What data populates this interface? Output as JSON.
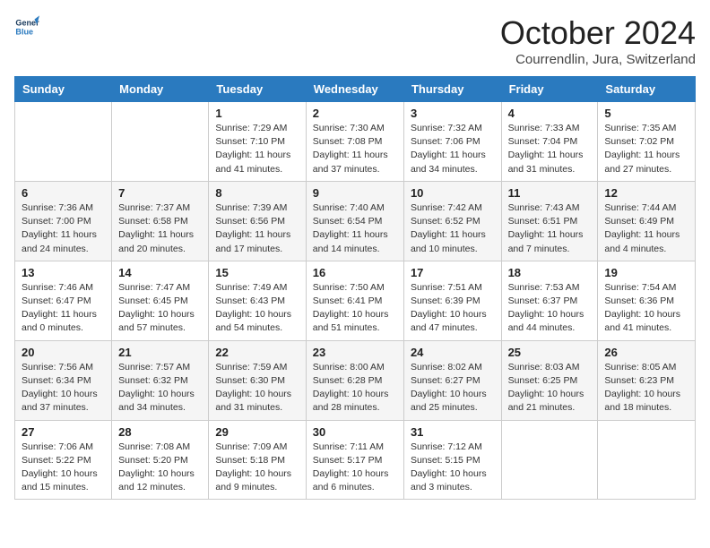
{
  "header": {
    "logo_line1": "General",
    "logo_line2": "Blue",
    "month": "October 2024",
    "location": "Courrendlin, Jura, Switzerland"
  },
  "days_of_week": [
    "Sunday",
    "Monday",
    "Tuesday",
    "Wednesday",
    "Thursday",
    "Friday",
    "Saturday"
  ],
  "weeks": [
    [
      {
        "day": "",
        "info": ""
      },
      {
        "day": "",
        "info": ""
      },
      {
        "day": "1",
        "info": "Sunrise: 7:29 AM\nSunset: 7:10 PM\nDaylight: 11 hours and 41 minutes."
      },
      {
        "day": "2",
        "info": "Sunrise: 7:30 AM\nSunset: 7:08 PM\nDaylight: 11 hours and 37 minutes."
      },
      {
        "day": "3",
        "info": "Sunrise: 7:32 AM\nSunset: 7:06 PM\nDaylight: 11 hours and 34 minutes."
      },
      {
        "day": "4",
        "info": "Sunrise: 7:33 AM\nSunset: 7:04 PM\nDaylight: 11 hours and 31 minutes."
      },
      {
        "day": "5",
        "info": "Sunrise: 7:35 AM\nSunset: 7:02 PM\nDaylight: 11 hours and 27 minutes."
      }
    ],
    [
      {
        "day": "6",
        "info": "Sunrise: 7:36 AM\nSunset: 7:00 PM\nDaylight: 11 hours and 24 minutes."
      },
      {
        "day": "7",
        "info": "Sunrise: 7:37 AM\nSunset: 6:58 PM\nDaylight: 11 hours and 20 minutes."
      },
      {
        "day": "8",
        "info": "Sunrise: 7:39 AM\nSunset: 6:56 PM\nDaylight: 11 hours and 17 minutes."
      },
      {
        "day": "9",
        "info": "Sunrise: 7:40 AM\nSunset: 6:54 PM\nDaylight: 11 hours and 14 minutes."
      },
      {
        "day": "10",
        "info": "Sunrise: 7:42 AM\nSunset: 6:52 PM\nDaylight: 11 hours and 10 minutes."
      },
      {
        "day": "11",
        "info": "Sunrise: 7:43 AM\nSunset: 6:51 PM\nDaylight: 11 hours and 7 minutes."
      },
      {
        "day": "12",
        "info": "Sunrise: 7:44 AM\nSunset: 6:49 PM\nDaylight: 11 hours and 4 minutes."
      }
    ],
    [
      {
        "day": "13",
        "info": "Sunrise: 7:46 AM\nSunset: 6:47 PM\nDaylight: 11 hours and 0 minutes."
      },
      {
        "day": "14",
        "info": "Sunrise: 7:47 AM\nSunset: 6:45 PM\nDaylight: 10 hours and 57 minutes."
      },
      {
        "day": "15",
        "info": "Sunrise: 7:49 AM\nSunset: 6:43 PM\nDaylight: 10 hours and 54 minutes."
      },
      {
        "day": "16",
        "info": "Sunrise: 7:50 AM\nSunset: 6:41 PM\nDaylight: 10 hours and 51 minutes."
      },
      {
        "day": "17",
        "info": "Sunrise: 7:51 AM\nSunset: 6:39 PM\nDaylight: 10 hours and 47 minutes."
      },
      {
        "day": "18",
        "info": "Sunrise: 7:53 AM\nSunset: 6:37 PM\nDaylight: 10 hours and 44 minutes."
      },
      {
        "day": "19",
        "info": "Sunrise: 7:54 AM\nSunset: 6:36 PM\nDaylight: 10 hours and 41 minutes."
      }
    ],
    [
      {
        "day": "20",
        "info": "Sunrise: 7:56 AM\nSunset: 6:34 PM\nDaylight: 10 hours and 37 minutes."
      },
      {
        "day": "21",
        "info": "Sunrise: 7:57 AM\nSunset: 6:32 PM\nDaylight: 10 hours and 34 minutes."
      },
      {
        "day": "22",
        "info": "Sunrise: 7:59 AM\nSunset: 6:30 PM\nDaylight: 10 hours and 31 minutes."
      },
      {
        "day": "23",
        "info": "Sunrise: 8:00 AM\nSunset: 6:28 PM\nDaylight: 10 hours and 28 minutes."
      },
      {
        "day": "24",
        "info": "Sunrise: 8:02 AM\nSunset: 6:27 PM\nDaylight: 10 hours and 25 minutes."
      },
      {
        "day": "25",
        "info": "Sunrise: 8:03 AM\nSunset: 6:25 PM\nDaylight: 10 hours and 21 minutes."
      },
      {
        "day": "26",
        "info": "Sunrise: 8:05 AM\nSunset: 6:23 PM\nDaylight: 10 hours and 18 minutes."
      }
    ],
    [
      {
        "day": "27",
        "info": "Sunrise: 7:06 AM\nSunset: 5:22 PM\nDaylight: 10 hours and 15 minutes."
      },
      {
        "day": "28",
        "info": "Sunrise: 7:08 AM\nSunset: 5:20 PM\nDaylight: 10 hours and 12 minutes."
      },
      {
        "day": "29",
        "info": "Sunrise: 7:09 AM\nSunset: 5:18 PM\nDaylight: 10 hours and 9 minutes."
      },
      {
        "day": "30",
        "info": "Sunrise: 7:11 AM\nSunset: 5:17 PM\nDaylight: 10 hours and 6 minutes."
      },
      {
        "day": "31",
        "info": "Sunrise: 7:12 AM\nSunset: 5:15 PM\nDaylight: 10 hours and 3 minutes."
      },
      {
        "day": "",
        "info": ""
      },
      {
        "day": "",
        "info": ""
      }
    ]
  ]
}
